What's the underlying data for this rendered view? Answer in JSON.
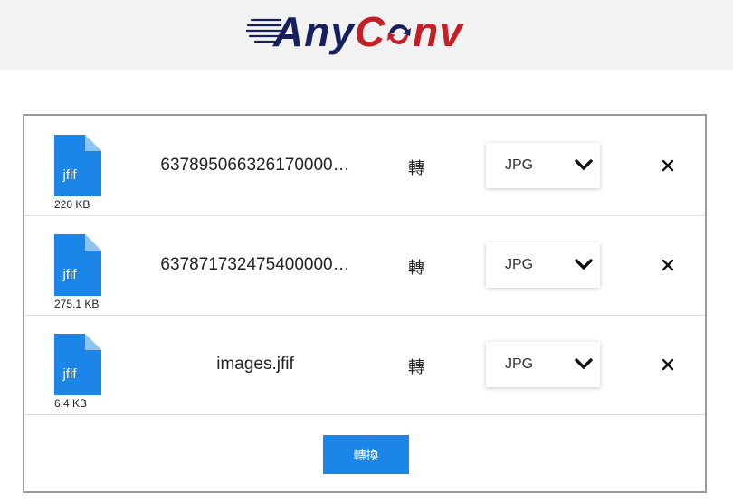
{
  "brand": {
    "logo_text_a": "Any",
    "logo_text_b": "C",
    "logo_text_c": "nv",
    "colors": {
      "navy": "#17205e",
      "red": "#c51f26",
      "accent": "#1c86e8"
    }
  },
  "files": [
    {
      "name": "637895066326170000…",
      "size": "220 KB",
      "ext": "jfif",
      "action": "轉",
      "format": "JPG"
    },
    {
      "name": "637871732475400000…",
      "size": "275.1 KB",
      "ext": "jfif",
      "action": "轉",
      "format": "JPG"
    },
    {
      "name": "images.jfif",
      "size": "6.4 KB",
      "ext": "jfif",
      "action": "轉",
      "format": "JPG"
    }
  ],
  "icons": {
    "file": "file-icon",
    "chevron": "chevron-down-icon",
    "remove": "close-icon"
  },
  "convert_button": {
    "label": "轉換"
  }
}
